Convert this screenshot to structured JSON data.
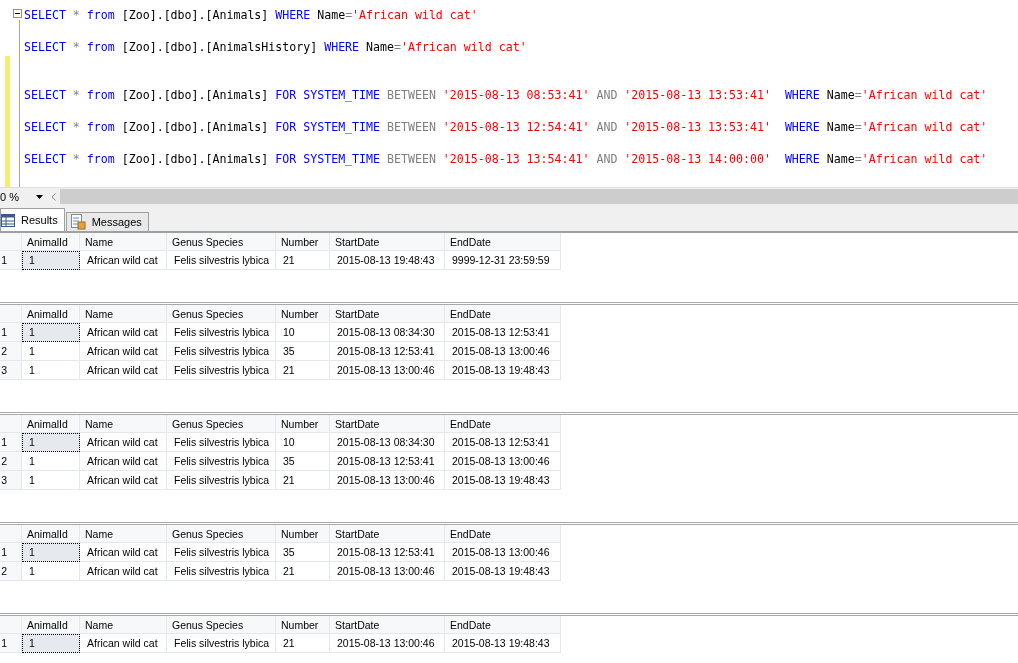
{
  "editor": {
    "statement_groups": [
      [
        {
          "tokens": [
            {
              "kind": "keyword",
              "text": "SELECT"
            },
            {
              "kind": "operator",
              "text": " * "
            },
            {
              "kind": "keyword",
              "text": "from"
            },
            {
              "kind": "plain",
              "text": " [Zoo].[dbo].[Animals] "
            },
            {
              "kind": "keyword",
              "text": "WHERE"
            },
            {
              "kind": "plain",
              "text": " Name"
            },
            {
              "kind": "operator",
              "text": "="
            },
            {
              "kind": "string",
              "text": "'African wild cat'"
            }
          ]
        },
        {
          "tokens": [
            {
              "kind": "keyword",
              "text": "SELECT"
            },
            {
              "kind": "operator",
              "text": " * "
            },
            {
              "kind": "keyword",
              "text": "from"
            },
            {
              "kind": "plain",
              "text": " [Zoo].[dbo].[AnimalsHistory] "
            },
            {
              "kind": "keyword",
              "text": "WHERE"
            },
            {
              "kind": "plain",
              "text": " Name"
            },
            {
              "kind": "operator",
              "text": "="
            },
            {
              "kind": "string",
              "text": "'African wild cat'"
            }
          ]
        }
      ],
      [
        {
          "tokens": [
            {
              "kind": "keyword",
              "text": "SELECT"
            },
            {
              "kind": "operator",
              "text": " * "
            },
            {
              "kind": "keyword",
              "text": "from"
            },
            {
              "kind": "plain",
              "text": " [Zoo].[dbo].[Animals] "
            },
            {
              "kind": "keyword",
              "text": "FOR SYSTEM_TIME"
            },
            {
              "kind": "operator",
              "text": " BETWEEN "
            },
            {
              "kind": "string",
              "text": "'2015-08-13 08:53:41'"
            },
            {
              "kind": "operator",
              "text": " AND "
            },
            {
              "kind": "string",
              "text": "'2015-08-13 13:53:41'  "
            },
            {
              "kind": "keyword",
              "text": "WHERE"
            },
            {
              "kind": "plain",
              "text": " Name"
            },
            {
              "kind": "operator",
              "text": "="
            },
            {
              "kind": "string",
              "text": "'African wild cat'"
            }
          ]
        },
        {
          "tokens": [
            {
              "kind": "keyword",
              "text": "SELECT"
            },
            {
              "kind": "operator",
              "text": " * "
            },
            {
              "kind": "keyword",
              "text": "from"
            },
            {
              "kind": "plain",
              "text": " [Zoo].[dbo].[Animals] "
            },
            {
              "kind": "keyword",
              "text": "FOR SYSTEM_TIME"
            },
            {
              "kind": "operator",
              "text": " BETWEEN "
            },
            {
              "kind": "string",
              "text": "'2015-08-13 12:54:41'"
            },
            {
              "kind": "operator",
              "text": " AND "
            },
            {
              "kind": "string",
              "text": "'2015-08-13 13:53:41'  "
            },
            {
              "kind": "keyword",
              "text": "WHERE"
            },
            {
              "kind": "plain",
              "text": " Name"
            },
            {
              "kind": "operator",
              "text": "="
            },
            {
              "kind": "string",
              "text": "'African wild cat'"
            }
          ]
        },
        {
          "tokens": [
            {
              "kind": "keyword",
              "text": "SELECT"
            },
            {
              "kind": "operator",
              "text": " * "
            },
            {
              "kind": "keyword",
              "text": "from"
            },
            {
              "kind": "plain",
              "text": " [Zoo].[dbo].[Animals] "
            },
            {
              "kind": "keyword",
              "text": "FOR SYSTEM_TIME"
            },
            {
              "kind": "operator",
              "text": " BETWEEN "
            },
            {
              "kind": "string",
              "text": "'2015-08-13 13:54:41'"
            },
            {
              "kind": "operator",
              "text": " AND "
            },
            {
              "kind": "string",
              "text": "'2015-08-13 14:00:00'  "
            },
            {
              "kind": "keyword",
              "text": "WHERE"
            },
            {
              "kind": "plain",
              "text": " Name"
            },
            {
              "kind": "operator",
              "text": "="
            },
            {
              "kind": "string",
              "text": "'African wild cat'"
            }
          ]
        }
      ]
    ]
  },
  "zoom": {
    "value": "0 %"
  },
  "tabs": [
    {
      "label": "Results",
      "selected": true,
      "kind": "grid"
    },
    {
      "label": "Messages",
      "selected": false,
      "kind": "messages"
    }
  ],
  "grids": [
    {
      "columns": [
        "AnimalId",
        "Name",
        "Genus Species",
        "Number",
        "StartDate",
        "EndDate"
      ],
      "rows": [
        {
          "row": "1",
          "focused": true,
          "cells": [
            "1",
            "African wild cat",
            "Felis silvestris lybica",
            "21",
            "2015-08-13 19:48:43",
            "9999-12-31 23:59:59"
          ]
        }
      ]
    },
    {
      "columns": [
        "AnimalId",
        "Name",
        "Genus Species",
        "Number",
        "StartDate",
        "EndDate"
      ],
      "rows": [
        {
          "row": "1",
          "focused": true,
          "cells": [
            "1",
            "African wild cat",
            "Felis silvestris lybica",
            "10",
            "2015-08-13 08:34:30",
            "2015-08-13 12:53:41"
          ]
        },
        {
          "row": "2",
          "focused": false,
          "cells": [
            "1",
            "African wild cat",
            "Felis silvestris lybica",
            "35",
            "2015-08-13 12:53:41",
            "2015-08-13 13:00:46"
          ]
        },
        {
          "row": "3",
          "focused": false,
          "cells": [
            "1",
            "African wild cat",
            "Felis silvestris lybica",
            "21",
            "2015-08-13 13:00:46",
            "2015-08-13 19:48:43"
          ]
        }
      ]
    },
    {
      "columns": [
        "AnimalId",
        "Name",
        "Genus Species",
        "Number",
        "StartDate",
        "EndDate"
      ],
      "rows": [
        {
          "row": "1",
          "focused": true,
          "cells": [
            "1",
            "African wild cat",
            "Felis silvestris lybica",
            "10",
            "2015-08-13 08:34:30",
            "2015-08-13 12:53:41"
          ]
        },
        {
          "row": "2",
          "focused": false,
          "cells": [
            "1",
            "African wild cat",
            "Felis silvestris lybica",
            "35",
            "2015-08-13 12:53:41",
            "2015-08-13 13:00:46"
          ]
        },
        {
          "row": "3",
          "focused": false,
          "cells": [
            "1",
            "African wild cat",
            "Felis silvestris lybica",
            "21",
            "2015-08-13 13:00:46",
            "2015-08-13 19:48:43"
          ]
        }
      ]
    },
    {
      "columns": [
        "AnimalId",
        "Name",
        "Genus Species",
        "Number",
        "StartDate",
        "EndDate"
      ],
      "rows": [
        {
          "row": "1",
          "focused": true,
          "cells": [
            "1",
            "African wild cat",
            "Felis silvestris lybica",
            "35",
            "2015-08-13 12:53:41",
            "2015-08-13 13:00:46"
          ]
        },
        {
          "row": "2",
          "focused": false,
          "cells": [
            "1",
            "African wild cat",
            "Felis silvestris lybica",
            "21",
            "2015-08-13 13:00:46",
            "2015-08-13 19:48:43"
          ]
        }
      ]
    },
    {
      "columns": [
        "AnimalId",
        "Name",
        "Genus Species",
        "Number",
        "StartDate",
        "EndDate"
      ],
      "rows": [
        {
          "row": "1",
          "focused": true,
          "cells": [
            "1",
            "African wild cat",
            "Felis silvestris lybica",
            "21",
            "2015-08-13 13:00:46",
            "2015-08-13 19:48:43"
          ]
        }
      ]
    }
  ]
}
